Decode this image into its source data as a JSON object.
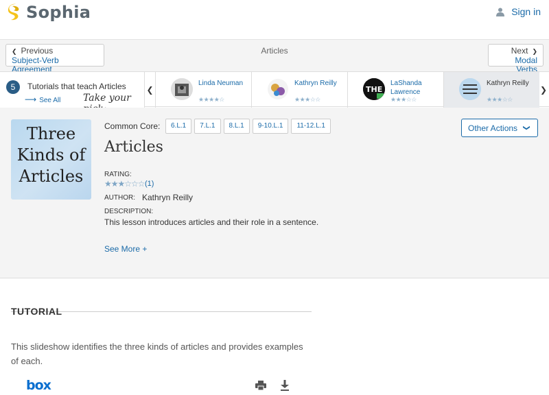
{
  "brand": {
    "name": "Sophia"
  },
  "header": {
    "signin_label": "Sign in"
  },
  "nav": {
    "prev_dir": "Previous",
    "prev_title": "Subject-Verb Agreement",
    "center": "Articles",
    "next_dir": "Next",
    "next_title": "Modal Verbs"
  },
  "tutorials": {
    "count": "5",
    "title": "Tutorials that teach Articles",
    "see_all": "See All",
    "pick": "Take your pick:",
    "cards": [
      {
        "name": "Linda Neuman",
        "stars": "★★★★☆"
      },
      {
        "name": "Kathryn Reilly",
        "stars": "★★★☆☆"
      },
      {
        "name": "LaShanda Lawrence",
        "stars": "★★★☆☆"
      },
      {
        "name": "Kathryn Reilly",
        "stars": "★★★☆☆"
      }
    ]
  },
  "lesson": {
    "thumbnail_text": "Three Kinds of Articles",
    "common_core_label": "Common Core:",
    "common_core_tags": [
      "6.L.1",
      "7.L.1",
      "8.L.1",
      "9-10.L.1",
      "11-12.L.1"
    ],
    "title": "Articles",
    "rating_label": "RATING:",
    "rating_stars": "★★★☆☆☆",
    "rating_count": "(1)",
    "author_label": "AUTHOR:",
    "author": "Kathryn Reilly",
    "description_label": "DESCRIPTION:",
    "description": "This lesson introduces articles and their role in a sentence.",
    "see_more": "See More +",
    "other_actions": "Other Actions"
  },
  "tutorial": {
    "heading": "TUTORIAL",
    "text": "This slideshow identifies the three kinds of articles and provides examples of each.",
    "box_logo": "box"
  },
  "colors": {
    "accent": "#1a6aa8",
    "badge": "#2a5d86",
    "brand_yellow": "#f5c31b"
  }
}
